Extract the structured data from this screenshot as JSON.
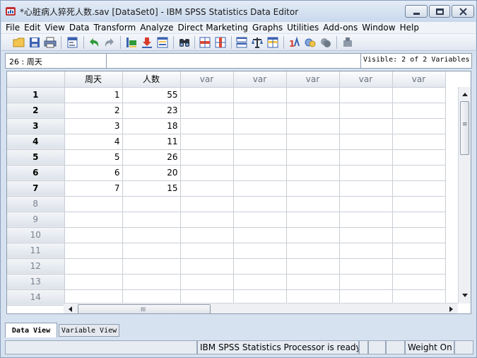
{
  "window": {
    "title": "*心脏病人猝死人数.sav [DataSet0] - IBM SPSS Statistics Data Editor"
  },
  "menu": [
    "File",
    "Edit",
    "View",
    "Data",
    "Transform",
    "Analyze",
    "Direct Marketing",
    "Graphs",
    "Utilities",
    "Add-ons",
    "Window",
    "Help"
  ],
  "toolbar": {
    "icons": [
      "open-folder-icon",
      "save-icon",
      "print-icon",
      "dialog-recall-icon",
      "undo-icon",
      "redo-icon",
      "goto-case-icon",
      "goto-variable-icon",
      "variables-icon",
      "find-icon",
      "insert-cases-icon",
      "insert-variable-icon",
      "split-file-icon",
      "weight-cases-icon",
      "select-cases-icon",
      "value-labels-icon",
      "use-variable-sets-icon",
      "show-all-variables-icon",
      "spell-check-icon"
    ]
  },
  "editor": {
    "cell_ref": "26 :  周天",
    "cell_value": "",
    "visible": "Visible: 2 of 2 Variables"
  },
  "grid": {
    "columns": [
      "周天",
      "人数",
      "var",
      "var",
      "var",
      "var",
      "var"
    ],
    "row_numbers": [
      "1",
      "2",
      "3",
      "4",
      "5",
      "6",
      "7",
      "8",
      "9",
      "10",
      "11",
      "12",
      "13",
      "14"
    ],
    "rows": [
      [
        "1",
        "55"
      ],
      [
        "2",
        "23"
      ],
      [
        "3",
        "18"
      ],
      [
        "4",
        "11"
      ],
      [
        "5",
        "26"
      ],
      [
        "6",
        "20"
      ],
      [
        "7",
        "15"
      ]
    ],
    "filled_rows": 7,
    "hscroll_grip": "III",
    "vscroll_grip": "≡"
  },
  "tabs": {
    "data_view": "Data View",
    "variable_view": "Variable View"
  },
  "status": {
    "processor": "IBM SPSS Statistics Processor is ready",
    "weight": "Weight On"
  }
}
